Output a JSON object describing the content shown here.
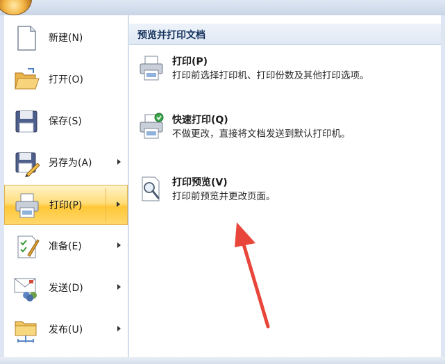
{
  "window": {
    "panel_title": "预览并打印文档"
  },
  "menu": {
    "items": [
      {
        "label": "新建(N)",
        "has_submenu": false
      },
      {
        "label": "打开(O)",
        "has_submenu": false
      },
      {
        "label": "保存(S)",
        "has_submenu": false
      },
      {
        "label": "另存为(A)",
        "has_submenu": true
      },
      {
        "label": "打印(P)",
        "has_submenu": true,
        "active": true
      },
      {
        "label": "准备(E)",
        "has_submenu": true
      },
      {
        "label": "发送(D)",
        "has_submenu": true
      },
      {
        "label": "发布(U)",
        "has_submenu": true
      }
    ]
  },
  "submenu": {
    "items": [
      {
        "name": "打印(P)",
        "desc": "打印前选择打印机、打印份数及其他打印选项。"
      },
      {
        "name": "快速打印(Q)",
        "desc": "不做更改，直接将文档发送到默认打印机。"
      },
      {
        "name": "打印预览(V)",
        "desc": "打印前预览并更改页面。"
      }
    ]
  },
  "icons": {
    "office_button": "office-orb-icon",
    "new": "blank-document-icon",
    "open": "open-folder-icon",
    "save": "floppy-disk-icon",
    "save_as": "save-as-icon",
    "print": "printer-icon",
    "prepare": "prepare-checklist-icon",
    "send": "send-envelope-icon",
    "publish": "publish-folder-icon",
    "quick_print": "quick-print-icon",
    "print_preview": "print-preview-icon",
    "annotation": "red-arrow-annotation"
  },
  "colors": {
    "active_item": "#ffd86c",
    "header_bg": "#dfe8f4",
    "annotation": "#e8463a"
  }
}
